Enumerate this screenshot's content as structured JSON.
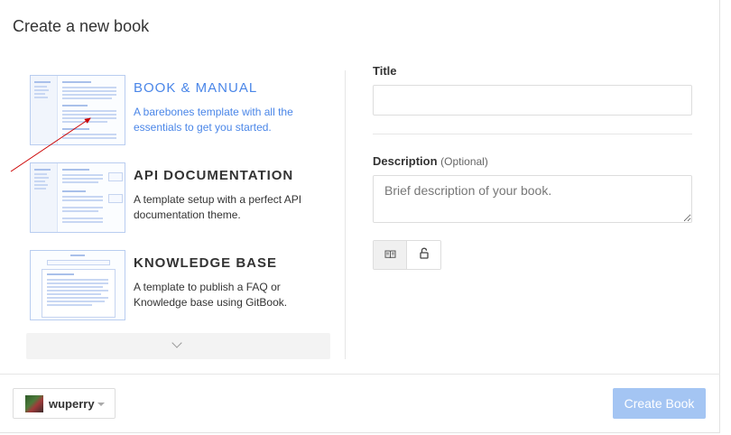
{
  "dialog": {
    "title": "Create a new book"
  },
  "templates": [
    {
      "title": "BOOK & MANUAL",
      "description": "A barebones template with all the essentials to get you started.",
      "selected": true
    },
    {
      "title": "API DOCUMENTATION",
      "description": "A template setup with a perfect API documentation theme.",
      "selected": false
    },
    {
      "title": "KNOWLEDGE BASE",
      "description": "A template to publish a FAQ or Knowledge base using GitBook.",
      "selected": false
    }
  ],
  "form": {
    "title_label": "Title",
    "title_value": "",
    "description_label": "Description",
    "description_optional": "(Optional)",
    "description_placeholder": "Brief description of your book.",
    "visibility_options": [
      {
        "icon": "book-open-icon",
        "active": true
      },
      {
        "icon": "lock-icon",
        "active": false
      }
    ]
  },
  "footer": {
    "username": "wuperry",
    "create_label": "Create Book"
  },
  "colors": {
    "accent": "#4a86e8",
    "create_button_disabled": "#a4c5f3",
    "annotation_arrow": "#cc0000"
  }
}
